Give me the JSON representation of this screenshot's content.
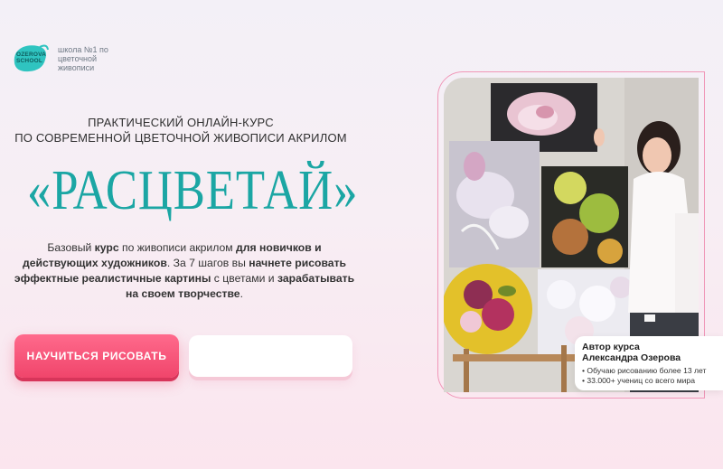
{
  "logo": {
    "brand": "OZEROVA SCHOOL",
    "brand_line1": "OZEROVA",
    "brand_line2": "SCHOOL",
    "tagline": "школа №1 по цветочной живописи",
    "accent": "#2fc4c0"
  },
  "hero": {
    "subtitle": "ПРАКТИЧЕСКИЙ ОНЛАЙН-КУРС\nПО СОВРЕМЕННОЙ ЦВЕТОЧНОЙ ЖИВОПИСИ АКРИЛОМ",
    "title": "«РАСЦВЕТАЙ»",
    "description": {
      "p1": "Базовый ",
      "p2": "курс",
      "p3": " по живописи акрилом ",
      "p4": "для новичков и действующих художников",
      "p5": ". За 7 шагов вы ",
      "p6": "начнете рисовать эффектные реалистичные картины",
      "p7": " с цветами и ",
      "p8": "зарабатывать на своем творчестве",
      "p9": "."
    }
  },
  "cta": {
    "primary_label": "НАУЧИТЬСЯ РИСОВАТЬ",
    "secondary_label": ""
  },
  "author": {
    "title": "Автор курса\nАлександра Озерова",
    "facts": [
      "Обучаю рисованию более 13 лет",
      "33.000+ учениц со всего мира"
    ]
  },
  "colors": {
    "accent_teal": "#1ba6a4",
    "button_pink": "#f0456b",
    "frame_pink": "#f097b8"
  }
}
